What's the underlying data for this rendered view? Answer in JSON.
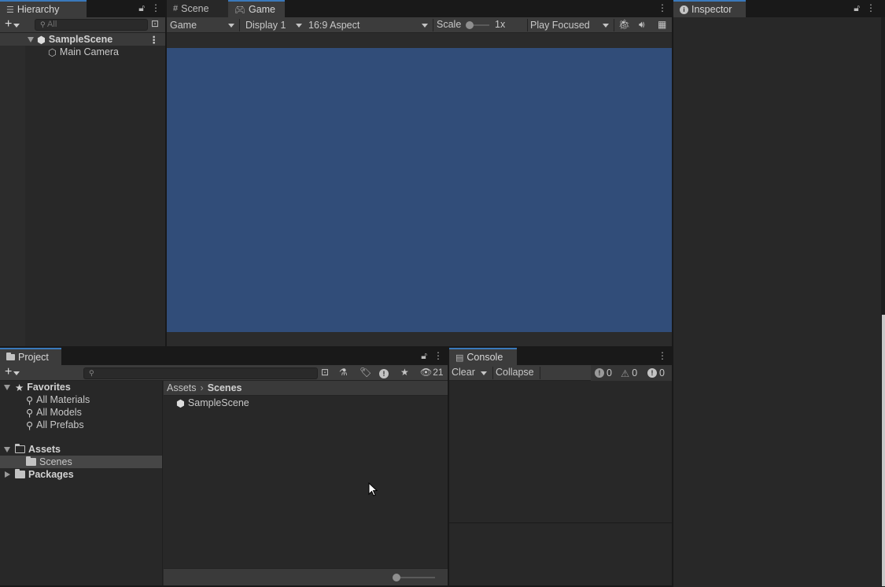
{
  "hierarchy": {
    "tab_label": "Hierarchy",
    "add_label": "+",
    "search_placeholder": "All",
    "scene_name": "SampleScene",
    "items": [
      {
        "label": "Main Camera"
      }
    ]
  },
  "center_tabs": [
    {
      "label": "Scene"
    },
    {
      "label": "Game"
    }
  ],
  "game_toolbar": {
    "view_dropdown": "Game",
    "display_dropdown": "Display 1",
    "aspect_dropdown": "16:9 Aspect",
    "scale_label": "Scale",
    "scale_value": "1x",
    "play_mode_dropdown": "Play Focused"
  },
  "game_view": {
    "background_color": "#314d79"
  },
  "inspector": {
    "tab_label": "Inspector"
  },
  "project": {
    "tab_label": "Project",
    "add_label": "+",
    "hidden_count": "21",
    "tree": {
      "favorites_label": "Favorites",
      "favorites": [
        {
          "label": "All Materials"
        },
        {
          "label": "All Models"
        },
        {
          "label": "All Prefabs"
        }
      ],
      "assets_label": "Assets",
      "assets_children": [
        {
          "label": "Scenes"
        }
      ],
      "packages_label": "Packages"
    },
    "breadcrumb": {
      "root": "Assets",
      "current": "Scenes"
    },
    "files": [
      {
        "label": "SampleScene"
      }
    ]
  },
  "console": {
    "tab_label": "Console",
    "clear_label": "Clear",
    "collapse_label": "Collapse",
    "log_count": "0",
    "warning_count": "0",
    "error_count": "0"
  },
  "colors": {
    "accent": "#3a79bb",
    "selection": "#464646"
  }
}
